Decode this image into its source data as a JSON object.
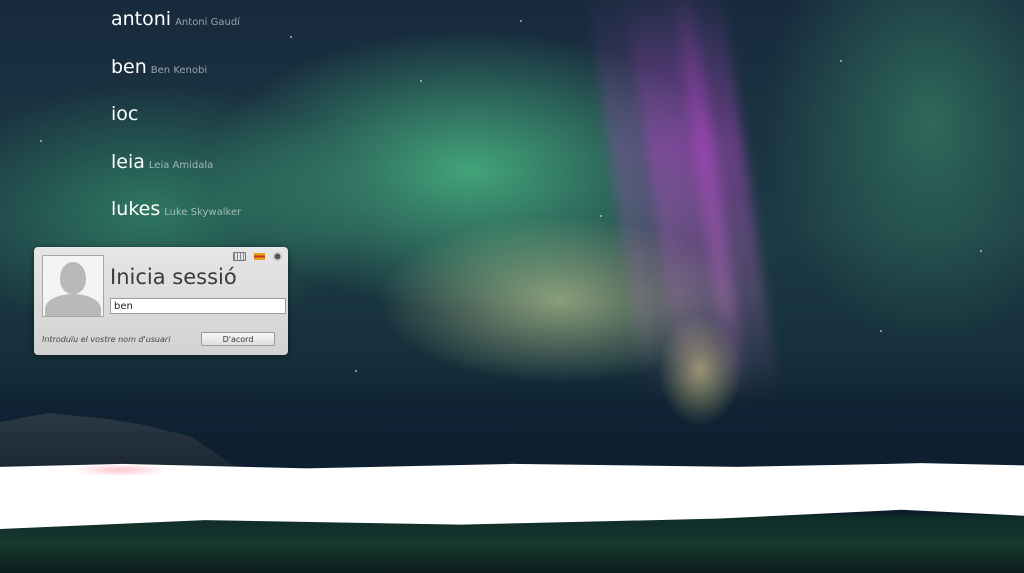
{
  "users": [
    {
      "login": "antoni",
      "full_name": "Antoni Gaudí"
    },
    {
      "login": "ben",
      "full_name": "Ben Kenobi"
    },
    {
      "login": "ioc",
      "full_name": ""
    },
    {
      "login": "leia",
      "full_name": "Leia Amidala"
    },
    {
      "login": "lukes",
      "full_name": "Luke Skywalker"
    }
  ],
  "login": {
    "title": "Inicia sessió",
    "username_value": "ben",
    "prompt": "Introduïu el vostre nom d'usuari",
    "ok_label": "D'acord",
    "icons": [
      "keyboard-icon",
      "language-flag-icon",
      "gear-icon"
    ]
  }
}
